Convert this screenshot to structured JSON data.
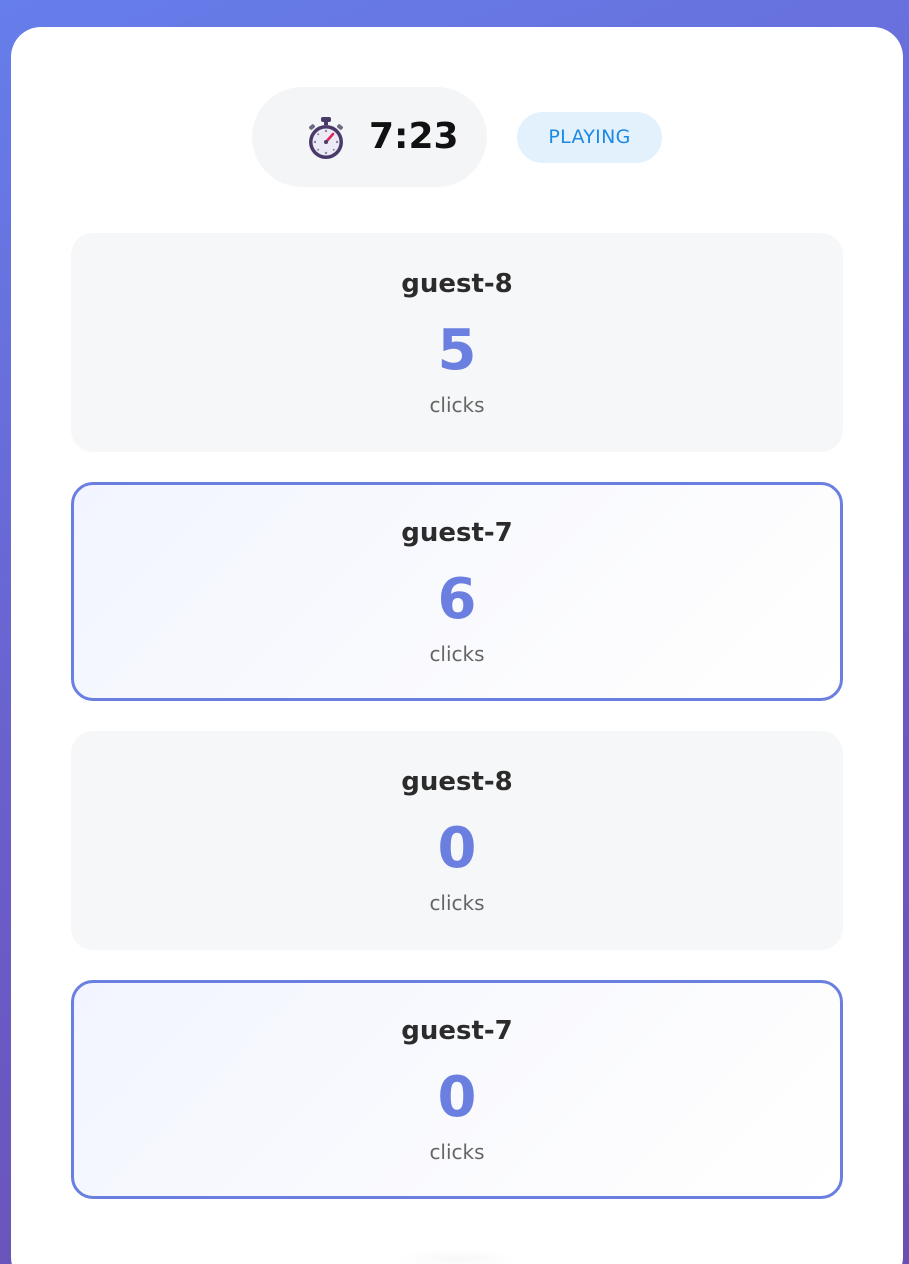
{
  "header": {
    "timer_icon": "stopwatch-icon",
    "timer": "7:23",
    "status": "PLAYING"
  },
  "players": [
    {
      "name": "guest-8",
      "score": "5",
      "unit": "clicks",
      "highlighted": false
    },
    {
      "name": "guest-7",
      "score": "6",
      "unit": "clicks",
      "highlighted": true
    },
    {
      "name": "guest-8",
      "score": "0",
      "unit": "clicks",
      "highlighted": false
    },
    {
      "name": "guest-7",
      "score": "0",
      "unit": "clicks",
      "highlighted": true
    }
  ],
  "colors": {
    "accent": "#6b7fe0",
    "status_text": "#1e88e5",
    "status_bg": "#e3f1fc",
    "background_start": "#667eea",
    "background_end": "#6a4fb0"
  }
}
